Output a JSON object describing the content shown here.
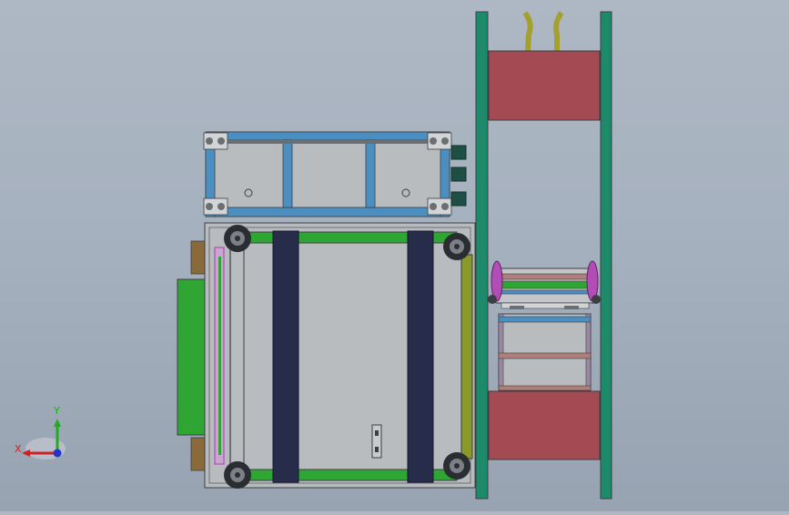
{
  "viewport": {
    "background_top": "#aeb8c4",
    "background_bottom": "#98a3b2"
  },
  "triad": {
    "x_label": "X",
    "y_label": "Y",
    "x_color": "#cc2222",
    "y_color": "#22aa22",
    "z_color": "#2233cc"
  },
  "colors": {
    "frame_green": "#1d8a6a",
    "block_red": "#a34a52",
    "panel_gray": "#b9bcbf",
    "outline": "#3b3f44",
    "beam_blue": "#4b8fc1",
    "belt_navy": "#272c4a",
    "rail_green": "#2fa533",
    "side_olive": "#8a9a2a",
    "bracket_magenta": "#b24cb6",
    "hose_olive": "#a3a030",
    "motor_teal": "#1e4f45"
  }
}
